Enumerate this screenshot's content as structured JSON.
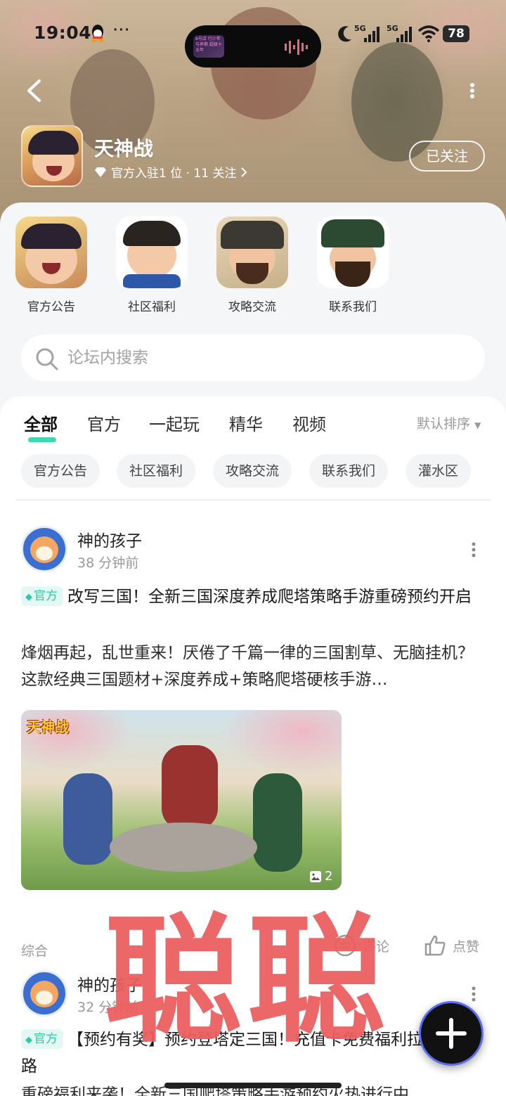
{
  "status_bar": {
    "time": "19:04",
    "island_text": "8号店 行少年与养鹅 超级十五年",
    "network": "5G",
    "battery": "78"
  },
  "forum": {
    "name": "天神战",
    "meta": "官方入驻1 位 · 11 关注",
    "follow_label": "已关注"
  },
  "quick_links": [
    {
      "label": "官方公告",
      "icon": "general-avatar"
    },
    {
      "label": "社区福利",
      "icon": "general-avatar"
    },
    {
      "label": "攻略交流",
      "icon": "general-avatar"
    },
    {
      "label": "联系我们",
      "icon": "general-avatar"
    }
  ],
  "search": {
    "placeholder": "论坛内搜索"
  },
  "tabs": [
    "全部",
    "官方",
    "一起玩",
    "精华",
    "视频"
  ],
  "sort_label": "默认排序",
  "chips": [
    "官方公告",
    "社区福利",
    "攻略交流",
    "联系我们",
    "灌水区"
  ],
  "posts": [
    {
      "author": "神的孩子",
      "time": "38 分钟前",
      "badge": "官方",
      "title": "改写三国！全新三国深度养成爬塔策略手游重磅预约开启",
      "body": "烽烟再起，乱世重来！厌倦了千篇一律的三国割草、无脑挂机？这款经典三国题材+深度养成+策略爬塔硬核手游…",
      "image_logo": "天神战",
      "image_count": "2",
      "category": "综合",
      "comment_label": "评论",
      "like_label": "点赞"
    },
    {
      "author": "神的孩子",
      "time": "32 分钟前",
      "badge": "官方",
      "title": "【预约有奖】预约登塔定三国！充值卡免费福利拉满不套路",
      "body": "重磅福利来袭！全新三国爬塔策略手游预约火热进行中"
    }
  ],
  "watermark": "聪聪",
  "colors": {
    "accent": "#3ed6b4",
    "watermark": "#ec5f5f",
    "badge_bg": "#e4f8f3"
  }
}
